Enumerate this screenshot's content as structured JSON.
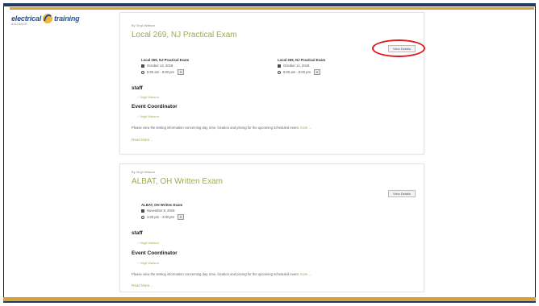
{
  "logo": {
    "word1": "electrical",
    "word2": "training",
    "tagline": "ALLIANCE"
  },
  "events": [
    {
      "by": "By Virgil Watson",
      "title": "Local 269, NJ Practical Exam",
      "view_details": "View Details",
      "occurrences": [
        {
          "name": "Local 269, NJ Practical Exam",
          "date": "October 13, 2018",
          "time": "8:00 am - 8:00 pm",
          "ical": "+"
        },
        {
          "name": "Local 269, NJ Practical Exam",
          "date": "October 14, 2018",
          "time": "8:00 am - 8:00 pm",
          "ical": "+"
        }
      ],
      "staff_heading": "staff",
      "staff_name": "Virgil Watson",
      "coordinator_heading": "Event Coordinator",
      "coordinator_name": "Virgil Watson",
      "description": "Please view the testing information concerning day, time, location and pricing for the upcoming scheduled event.",
      "more": "more ...",
      "read_more": "Read More..."
    },
    {
      "by": "By Virgil Watson",
      "title": "ALBAT, OH Written Exam",
      "view_details": "View Details",
      "occurrences": [
        {
          "name": "ALBAT, OH Written Exam",
          "date": "November 8, 2018",
          "time": "1:00 pm - 4:00 pm",
          "ical": "+"
        }
      ],
      "staff_heading": "staff",
      "staff_name": "Virgil Watson",
      "coordinator_heading": "Event Coordinator",
      "coordinator_name": "Virgil Watson",
      "description": "Please view the testing information concerning day, time, location and pricing for the upcoming scheduled event.",
      "more": "more ...",
      "read_more": "Read More..."
    }
  ],
  "colors": {
    "accent": "#a1ab4a",
    "gold": "#d8a23a",
    "navy": "#243a5e",
    "highlight": "#e0191f"
  },
  "icons": [
    "calendar-icon",
    "clock-icon",
    "ical-export-icon",
    "chevron-right-icon"
  ]
}
